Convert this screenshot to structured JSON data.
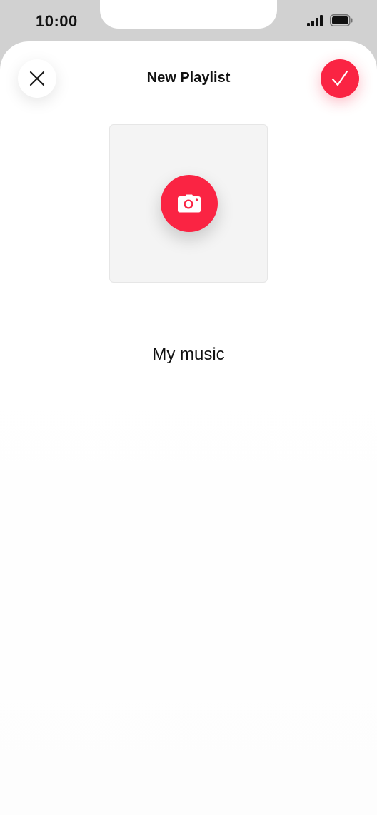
{
  "status_bar": {
    "time": "10:00",
    "icons": [
      "signal-icon",
      "battery-icon"
    ]
  },
  "header": {
    "title": "New Playlist",
    "close_icon": "close-icon",
    "done_icon": "checkmark-icon"
  },
  "artwork": {
    "camera_icon": "camera-icon"
  },
  "playlist_name": {
    "value": "My music"
  },
  "colors": {
    "accent": "#fa2443",
    "background": "#ffffff",
    "device_frame": "#d1d1d1",
    "artwork_placeholder": "#f4f4f4"
  }
}
